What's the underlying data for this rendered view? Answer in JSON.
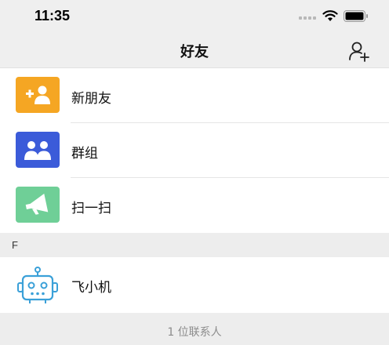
{
  "status": {
    "time": "11:35"
  },
  "nav": {
    "title": "好友",
    "add_icon": "add-friend-icon"
  },
  "entries": [
    {
      "label": "新朋友",
      "icon": "new-friend-icon",
      "color": "#f5a623"
    },
    {
      "label": "群组",
      "icon": "group-icon",
      "color": "#3b5bd9"
    },
    {
      "label": "扫一扫",
      "icon": "megaphone-icon",
      "color": "#6fcf97"
    }
  ],
  "section": {
    "letter": "F"
  },
  "contacts": [
    {
      "name": "飞小机",
      "icon": "robot-icon"
    }
  ],
  "footer": {
    "count_text": "1 位联系人"
  }
}
